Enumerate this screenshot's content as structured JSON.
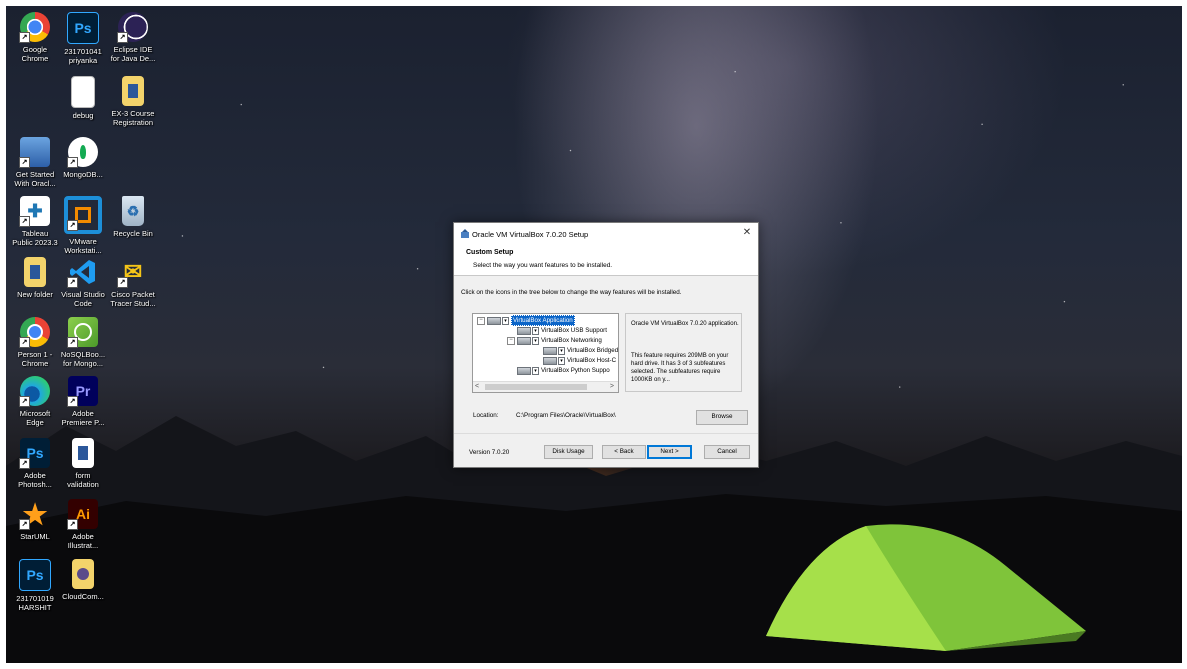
{
  "desktop_icons": [
    {
      "label": "Google\nChrome",
      "icon": "chrome-icon"
    },
    {
      "label": "231701041\npriyanka",
      "icon": "photoshop-file-icon"
    },
    {
      "label": "Eclipse IDE\nfor Java De...",
      "icon": "eclipse-icon"
    },
    {
      "label": "debug",
      "icon": "text-file-icon"
    },
    {
      "label": "EX-3 Course\nRegistration",
      "icon": "document-file-icon"
    },
    {
      "label": "Get Started\nWith Oracl...",
      "icon": "oracle-database-icon"
    },
    {
      "label": "MongoDB...",
      "icon": "mongodb-icon"
    },
    {
      "label": "Tableau\nPublic 2023.3",
      "icon": "tableau-icon"
    },
    {
      "label": "VMware\nWorkstati...",
      "icon": "vmware-icon"
    },
    {
      "label": "Recycle Bin",
      "icon": "recycle-bin-icon"
    },
    {
      "label": "New folder",
      "icon": "folder-icon"
    },
    {
      "label": "Visual Studio\nCode",
      "icon": "vscode-icon"
    },
    {
      "label": "Cisco Packet\nTracer Stud...",
      "icon": "cisco-packet-tracer-icon"
    },
    {
      "label": "Person 1 -\nChrome",
      "icon": "chrome-profile-icon"
    },
    {
      "label": "NoSQLBoo...\nfor Mongo...",
      "icon": "nosqlbooster-icon"
    },
    {
      "label": "Microsoft\nEdge",
      "icon": "edge-icon"
    },
    {
      "label": "Adobe\nPremiere P...",
      "icon": "premiere-pro-icon"
    },
    {
      "label": "Adobe\nPhotosh...",
      "icon": "photoshop-icon"
    },
    {
      "label": "form\nvalidation",
      "icon": "file-icon"
    },
    {
      "label": "StarUML",
      "icon": "staruml-icon"
    },
    {
      "label": "Adobe\nIllustrat...",
      "icon": "illustrator-icon"
    },
    {
      "label": "231701019\nHARSHIT",
      "icon": "photoshop-file-icon"
    },
    {
      "label": "CloudCom...",
      "icon": "cloud-file-icon"
    }
  ],
  "dialog": {
    "title": "Oracle VM VirtualBox 7.0.20 Setup",
    "close": "✕",
    "header_title": "Custom Setup",
    "header_subtitle": "Select the way you want features to be installed.",
    "instruction": "Click on the icons in the tree below to change the way features will be installed.",
    "tree": [
      {
        "label": "VirtualBox Application",
        "selected": true
      },
      {
        "label": "VirtualBox USB Support"
      },
      {
        "label": "VirtualBox Networking"
      },
      {
        "label": "VirtualBox Bridged"
      },
      {
        "label": "VirtualBox Host-C"
      },
      {
        "label": "VirtualBox Python Suppo"
      }
    ],
    "tree_expander_minus": "−",
    "scroll_left": "<",
    "scroll_right": ">",
    "description_1": "Oracle VM VirtualBox 7.0.20 application.",
    "description_2": "This feature requires 209MB on your hard drive. It has 3 of 3 subfeatures selected. The subfeatures require 1000KB on y...",
    "location_label": "Location:",
    "location_value": "C:\\Program Files\\Oracle\\VirtualBox\\",
    "browse_label": "Browse",
    "version": "Version 7.0.20",
    "disk_usage_label": "Disk Usage",
    "back_label": "< Back",
    "next_label": "Next >",
    "cancel_label": "Cancel"
  }
}
